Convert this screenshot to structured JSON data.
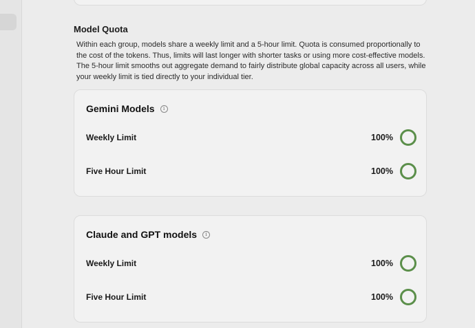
{
  "section": {
    "title": "Model Quota",
    "description": "Within each group, models share a weekly limit and a 5-hour limit. Quota is consumed proportionally to the cost of the tokens. Thus, limits will last longer with shorter tasks or using more cost-effective models. The 5-hour limit smooths out aggregate demand to fairly distribute global capacity across all users, while your weekly limit is tied directly to your individual tier."
  },
  "groups": [
    {
      "title": "Gemini Models",
      "info_icon": "info-icon",
      "limits": [
        {
          "label": "Weekly Limit",
          "value": "100%",
          "fraction": 1.0
        },
        {
          "label": "Five Hour Limit",
          "value": "100%",
          "fraction": 1.0
        }
      ]
    },
    {
      "title": "Claude and GPT models",
      "info_icon": "info-icon",
      "limits": [
        {
          "label": "Weekly Limit",
          "value": "100%",
          "fraction": 1.0
        },
        {
          "label": "Five Hour Limit",
          "value": "100%",
          "fraction": 1.0
        }
      ]
    }
  ],
  "colors": {
    "ring": "#5b8f4a",
    "background": "#ececec",
    "card": "#f2f2f2"
  }
}
